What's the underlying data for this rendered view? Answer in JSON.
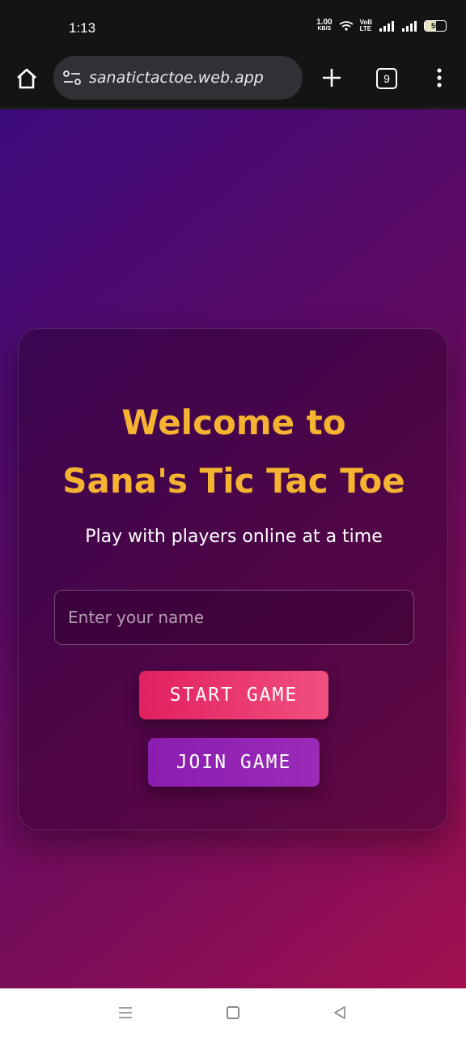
{
  "status_bar": {
    "time": "1:13",
    "net_speed_value": "1.00",
    "net_speed_unit": "KB/S",
    "volte_top": "VoB",
    "volte_bottom": "LTE",
    "battery_level": "55"
  },
  "browser": {
    "url": "sanatictactoe.web.app",
    "tab_count": "9",
    "icons": [
      "home-icon",
      "site-settings-icon",
      "plus-icon",
      "tabs-icon",
      "overflow-menu-icon"
    ]
  },
  "main": {
    "title_line1": "Welcome to",
    "title_line2": "Sana's Tic Tac Toe",
    "subtitle": "Play with players online at a time",
    "name_input": {
      "placeholder": "Enter your name",
      "value": ""
    },
    "start_button_label": "START GAME",
    "join_button_label": "JOIN GAME"
  },
  "colors": {
    "title": "#f5b331",
    "start_button": "#e2205f",
    "join_button": "#8a1eb0",
    "background_start": "#3d0b7e",
    "background_end": "#a3104f"
  },
  "nav_bar": {
    "icons": [
      "recent-apps-icon",
      "home-nav-icon",
      "back-icon"
    ]
  }
}
